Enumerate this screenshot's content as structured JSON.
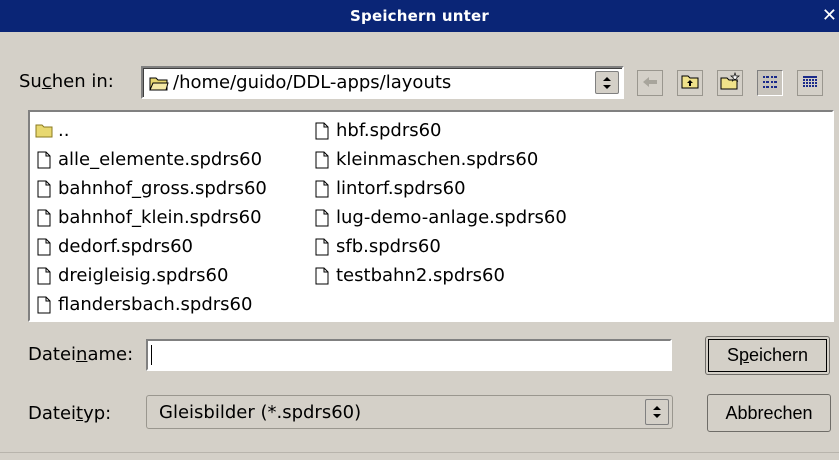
{
  "window": {
    "title": "Speichern unter"
  },
  "lookin": {
    "label_prefix": "Su",
    "label_ul": "c",
    "label_suffix": "hen in:",
    "path": "/home/guido/DDL-apps/layouts"
  },
  "toolbar": {
    "back_icon": "back-arrow-icon",
    "up_icon": "folder-up-icon",
    "newfolder_icon": "new-folder-icon",
    "list_icon": "list-view-icon",
    "detail_icon": "detail-view-icon"
  },
  "files": {
    "col1": [
      {
        "name": "..",
        "type": "folder"
      },
      {
        "name": "alle_elemente.spdrs60",
        "type": "file"
      },
      {
        "name": "bahnhof_gross.spdrs60",
        "type": "file"
      },
      {
        "name": "bahnhof_klein.spdrs60",
        "type": "file"
      },
      {
        "name": "dedorf.spdrs60",
        "type": "file"
      },
      {
        "name": "dreigleisig.spdrs60",
        "type": "file"
      },
      {
        "name": "flandersbach.spdrs60",
        "type": "file"
      }
    ],
    "col2": [
      {
        "name": "hbf.spdrs60",
        "type": "file"
      },
      {
        "name": "kleinmaschen.spdrs60",
        "type": "file"
      },
      {
        "name": "lintorf.spdrs60",
        "type": "file"
      },
      {
        "name": "lug-demo-anlage.spdrs60",
        "type": "file"
      },
      {
        "name": "sfb.spdrs60",
        "type": "file"
      },
      {
        "name": "testbahn2.spdrs60",
        "type": "file"
      }
    ]
  },
  "filename": {
    "label_prefix": "Datei",
    "label_ul": "n",
    "label_suffix": "ame:",
    "value": ""
  },
  "filetype": {
    "label_prefix": "Datei",
    "label_ul": "t",
    "label_suffix": "yp:",
    "value": "Gleisbilder (*.spdrs60)"
  },
  "buttons": {
    "save_prefix": "S",
    "save_ul": "p",
    "save_suffix": "eichern",
    "cancel": "Abbrechen"
  },
  "colors": {
    "titlebar": "#0a2576",
    "dialog": "#d4d0c8"
  }
}
